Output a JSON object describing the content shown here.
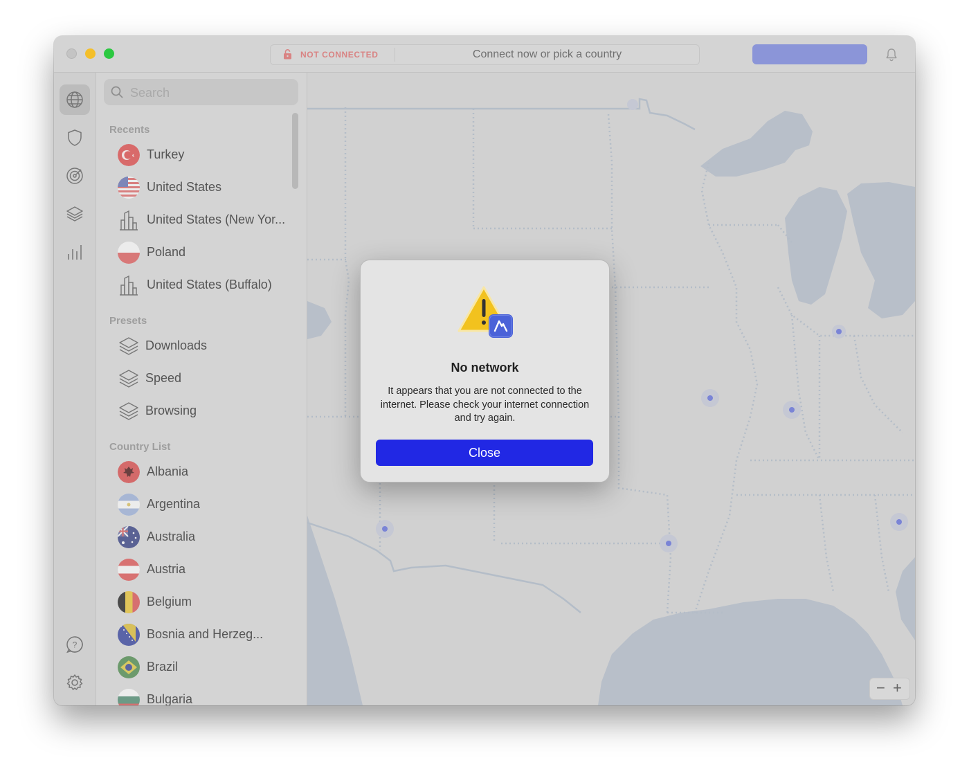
{
  "titlebar": {
    "status": "NOT CONNECTED",
    "prompt": "Connect now or pick a country"
  },
  "rail": {
    "items": [
      "globe-icon",
      "shield-icon",
      "target-icon",
      "layers-icon",
      "stats-icon"
    ],
    "bottom": [
      "help-icon",
      "gear-icon"
    ]
  },
  "search": {
    "placeholder": "Search"
  },
  "sidebar": {
    "recents_heading": "Recents",
    "recents": [
      "Turkey",
      "United States",
      "United States (New Yor...",
      "Poland",
      "United States (Buffalo)"
    ],
    "presets_heading": "Presets",
    "presets": [
      "Downloads",
      "Speed",
      "Browsing"
    ],
    "countries_heading": "Country List",
    "countries": [
      "Albania",
      "Argentina",
      "Australia",
      "Austria",
      "Belgium",
      "Bosnia and Herzeg...",
      "Brazil",
      "Bulgaria"
    ]
  },
  "map": {
    "zoom_out": "−",
    "zoom_in": "+"
  },
  "dialog": {
    "title": "No network",
    "body": "It appears that you are not connected to the internet. Please check your internet connection and try again.",
    "button": "Close"
  },
  "colors": {
    "accent": "#2128e4",
    "status_red": "#d98383",
    "quick_connect": "#8b95d8",
    "map_water": "#b8bfc9",
    "server_pin": "#7a84d6"
  }
}
